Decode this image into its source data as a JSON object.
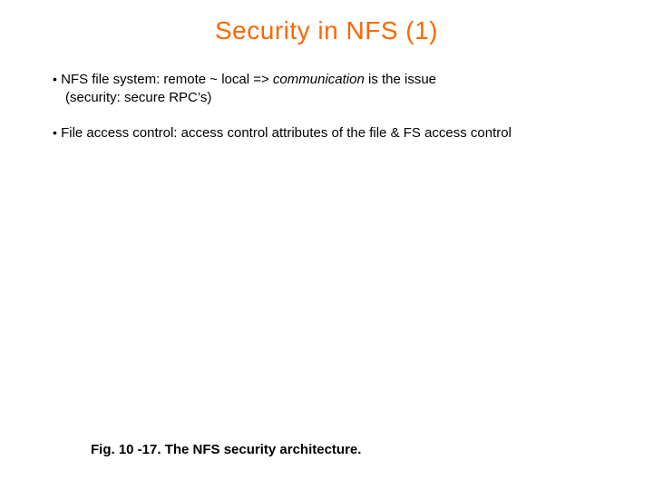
{
  "title": "Security in NFS  (1)",
  "bullets": [
    {
      "mark": "•",
      "line1_prefix": "NFS file system:  remote ~ local  => ",
      "line1_em": "communication",
      "line1_suffix": " is the issue",
      "line2": "(security: secure RPC’s)"
    },
    {
      "mark": "•",
      "line1": "File access control:  access control attributes of the file & FS access control"
    }
  ],
  "caption": "Fig. 10 -17. The NFS security architecture."
}
